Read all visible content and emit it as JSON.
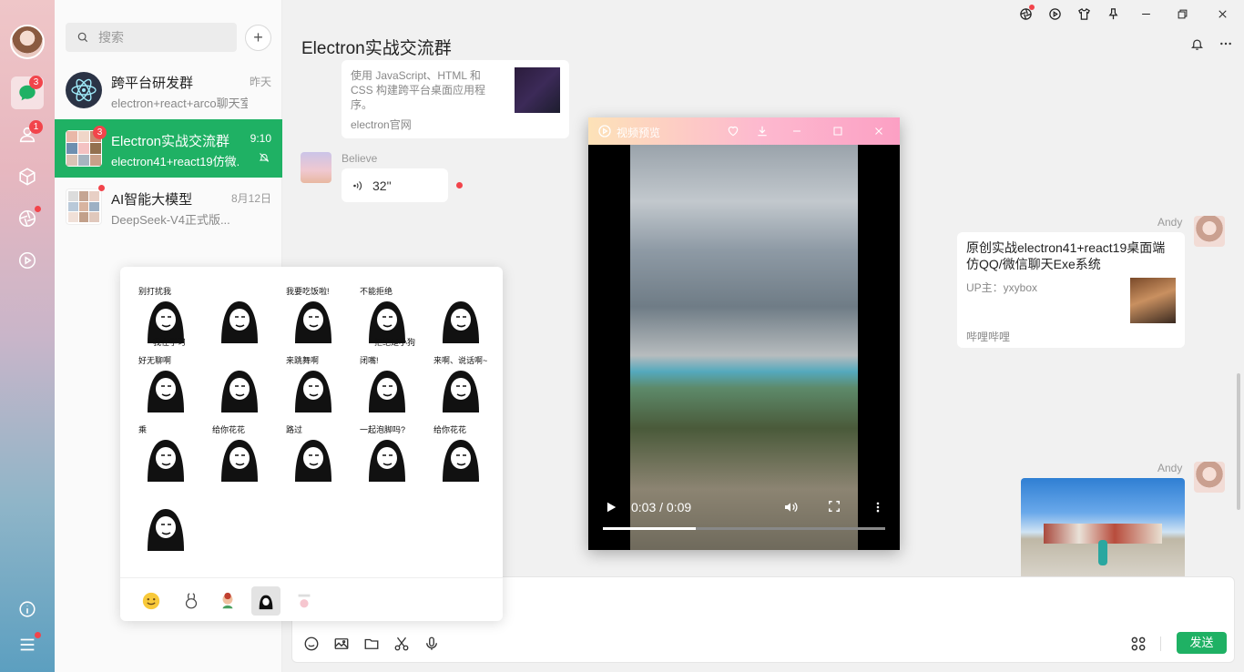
{
  "app": {
    "accent": "#1fb164",
    "badge_color": "#f2444b"
  },
  "rail": {
    "chat_badge": "3",
    "contacts_badge": "1"
  },
  "search": {
    "placeholder": "搜索"
  },
  "conversations": [
    {
      "name": "跨平台研发群",
      "preview": "electron+react+arco聊天室",
      "time": "昨天"
    },
    {
      "name": "Electron实战交流群",
      "preview": "electron41+react19仿微...",
      "time": "9:10",
      "badge": "3",
      "active": true
    },
    {
      "name": "AI智能大模型",
      "preview": "DeepSeek-V4正式版...",
      "time": "8月12日"
    }
  ],
  "chat": {
    "title": "Electron实战交流群",
    "link_card": {
      "desc": "使用 JavaScript、HTML 和 CSS 构建跨平台桌面应用程序。",
      "source": "electron官网"
    },
    "voice_msg": {
      "sender": "Believe",
      "duration": "32\""
    },
    "share_card": {
      "sender": "Andy",
      "title": "原创实战electron41+react19桌面端仿QQ/微信聊天Exe系统",
      "up": "UP主：yxybox",
      "source": "哔哩哔哩"
    },
    "photo_msg": {
      "sender": "Andy"
    }
  },
  "input": {
    "send_label": "发送"
  },
  "emoji_panel": {
    "stickers": [
      {
        "caption": "别打扰我",
        "caption2": "我在学习"
      },
      {
        "caption": ""
      },
      {
        "caption": "我要吃饭啦!"
      },
      {
        "caption": "不能拒绝",
        "caption2": "拒绝是小狗"
      },
      {
        "caption": ""
      },
      {
        "caption": "好无聊啊"
      },
      {
        "caption": ""
      },
      {
        "caption": "来跳舞啊"
      },
      {
        "caption": "闭嘴!"
      },
      {
        "caption": "来啊、说话啊~"
      },
      {
        "caption": "乘"
      },
      {
        "caption": "给你花花"
      },
      {
        "caption": "路过"
      },
      {
        "caption": "一起泡脚吗?"
      },
      {
        "caption": "给你花花"
      },
      {
        "caption": ""
      }
    ]
  },
  "video": {
    "title": "视频预览",
    "time": "0:03 / 0:09",
    "progress": 0.33
  }
}
